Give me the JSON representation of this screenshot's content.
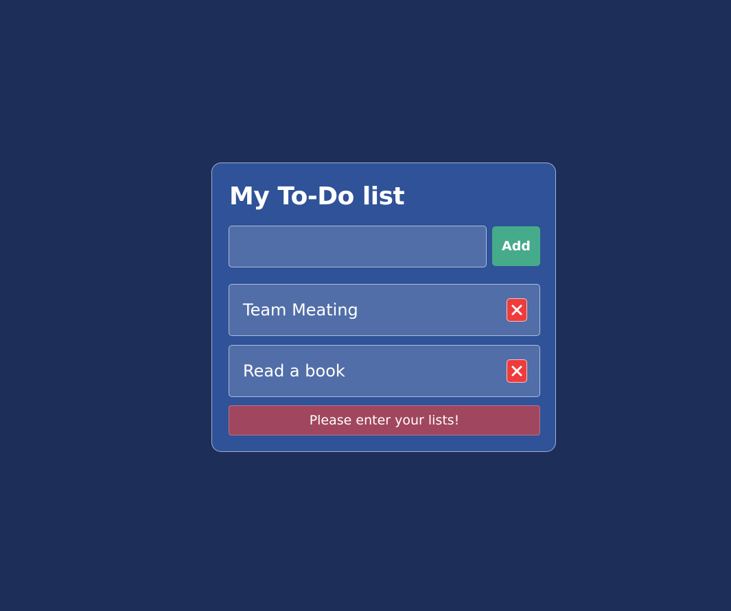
{
  "app": {
    "title": "My To-Do list"
  },
  "form": {
    "input_value": "",
    "input_placeholder": "",
    "add_label": "Add"
  },
  "todos": [
    {
      "label": "Team Meating"
    },
    {
      "label": "Read a book"
    }
  ],
  "alert": {
    "message": "Please enter your lists!"
  },
  "colors": {
    "background": "#1d2f59",
    "card": "#2f5298",
    "field": "#516ea8",
    "add_button": "#45ab8a",
    "delete_button": "#ef3b3b",
    "alert": "#a0465f"
  },
  "icons": {
    "delete": "close-icon"
  }
}
